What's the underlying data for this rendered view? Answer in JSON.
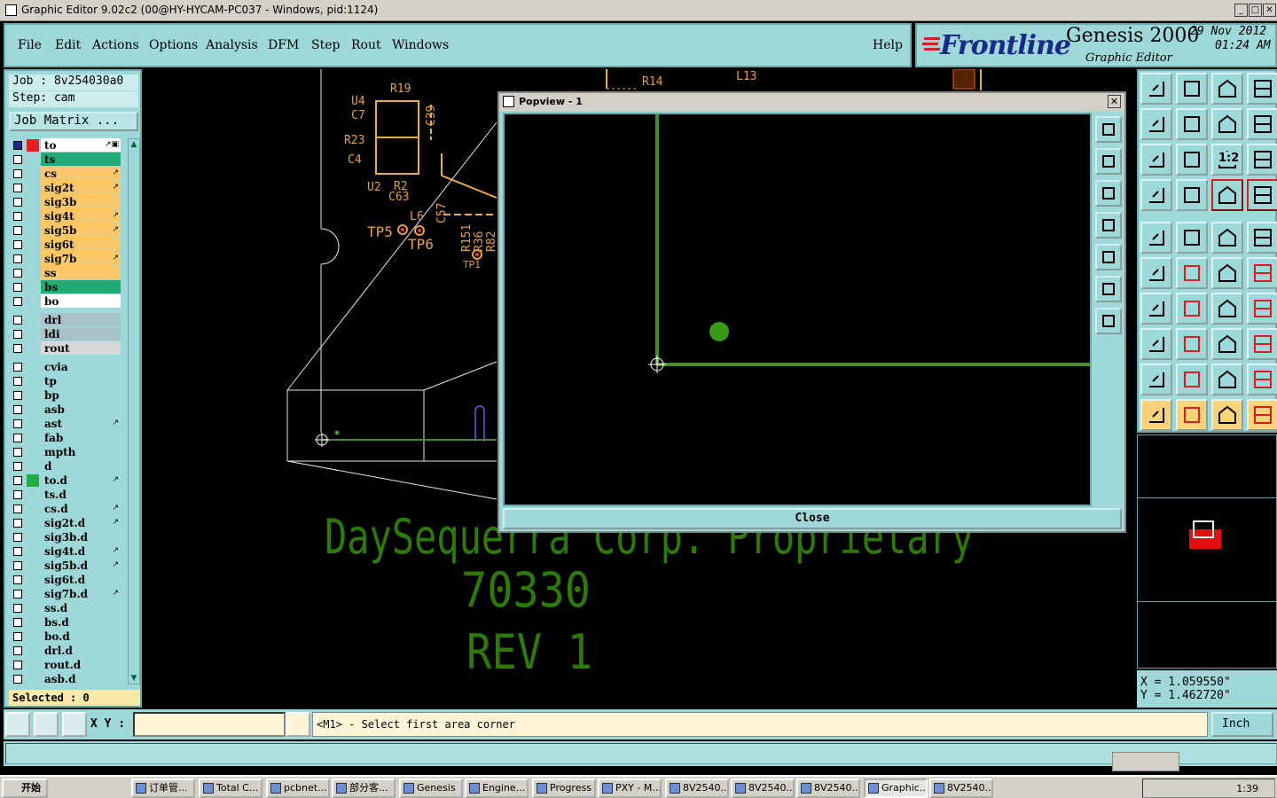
{
  "window": {
    "title": "Graphic Editor 9.02c2 (00@HY-HYCAM-PC037 - Windows, pid:1124)"
  },
  "menu": {
    "items": [
      "File",
      "Edit",
      "Actions",
      "Options",
      "Analysis",
      "DFM",
      "Step",
      "Rout",
      "Windows"
    ],
    "help": "Help"
  },
  "brand": {
    "logo": "Frontline",
    "product": "Genesis 2000",
    "subtitle": "Graphic Editor",
    "date": "29 Nov 2012",
    "time": "01:24 AM"
  },
  "job": {
    "job_line": "Job : 8v254030a0",
    "step_line": "Step: cam",
    "matrix_button": "Job Matrix ..."
  },
  "layers": [
    {
      "name": "to",
      "color": "#ffffff",
      "flag": "#e52020",
      "mark": "↗▣"
    },
    {
      "name": "ts",
      "color": "#22aa77",
      "flag": "",
      "mark": ""
    },
    {
      "name": "cs",
      "color": "#f9c86a",
      "flag": "",
      "mark": "↗"
    },
    {
      "name": "sig2t",
      "color": "#f9c86a",
      "flag": "",
      "mark": "↗"
    },
    {
      "name": "sig3b",
      "color": "#f9c86a",
      "flag": "",
      "mark": ""
    },
    {
      "name": "sig4t",
      "color": "#f9c86a",
      "flag": "",
      "mark": "↗"
    },
    {
      "name": "sig5b",
      "color": "#f9c86a",
      "flag": "",
      "mark": "↗"
    },
    {
      "name": "sig6t",
      "color": "#f9c86a",
      "flag": "",
      "mark": ""
    },
    {
      "name": "sig7b",
      "color": "#f9c86a",
      "flag": "",
      "mark": "↗"
    },
    {
      "name": "ss",
      "color": "#f9c86a",
      "flag": "",
      "mark": ""
    },
    {
      "name": "bs",
      "color": "#22aa77",
      "flag": "",
      "mark": ""
    },
    {
      "name": "bo",
      "color": "#ffffff",
      "flag": "",
      "mark": ""
    },
    {
      "name": "drl",
      "color": "#a8c4c8",
      "flag": "",
      "mark": ""
    },
    {
      "name": "ldi",
      "color": "#a8c4c8",
      "flag": "",
      "mark": ""
    },
    {
      "name": "rout",
      "color": "#d8d8d8",
      "flag": "",
      "mark": ""
    },
    {
      "name": "cvia",
      "color": "#9fd8d8",
      "flag": "",
      "mark": ""
    },
    {
      "name": "tp",
      "color": "#9fd8d8",
      "flag": "",
      "mark": ""
    },
    {
      "name": "bp",
      "color": "#9fd8d8",
      "flag": "",
      "mark": ""
    },
    {
      "name": "asb",
      "color": "#9fd8d8",
      "flag": "",
      "mark": ""
    },
    {
      "name": "ast",
      "color": "#9fd8d8",
      "flag": "",
      "mark": "↗"
    },
    {
      "name": "fab",
      "color": "#9fd8d8",
      "flag": "",
      "mark": ""
    },
    {
      "name": "mpth",
      "color": "#9fd8d8",
      "flag": "",
      "mark": ""
    },
    {
      "name": "d",
      "color": "#9fd8d8",
      "flag": "",
      "mark": ""
    },
    {
      "name": "to.d",
      "color": "#9fd8d8",
      "flag": "#22aa44",
      "mark": "↗"
    },
    {
      "name": "ts.d",
      "color": "#9fd8d8",
      "flag": "",
      "mark": ""
    },
    {
      "name": "cs.d",
      "color": "#9fd8d8",
      "flag": "",
      "mark": "↗"
    },
    {
      "name": "sig2t.d",
      "color": "#9fd8d8",
      "flag": "",
      "mark": "↗"
    },
    {
      "name": "sig3b.d",
      "color": "#9fd8d8",
      "flag": "",
      "mark": ""
    },
    {
      "name": "sig4t.d",
      "color": "#9fd8d8",
      "flag": "",
      "mark": "↗"
    },
    {
      "name": "sig5b.d",
      "color": "#9fd8d8",
      "flag": "",
      "mark": "↗"
    },
    {
      "name": "sig6t.d",
      "color": "#9fd8d8",
      "flag": "",
      "mark": ""
    },
    {
      "name": "sig7b.d",
      "color": "#9fd8d8",
      "flag": "",
      "mark": "↗"
    },
    {
      "name": "ss.d",
      "color": "#9fd8d8",
      "flag": "",
      "mark": ""
    },
    {
      "name": "bs.d",
      "color": "#9fd8d8",
      "flag": "",
      "mark": ""
    },
    {
      "name": "bo.d",
      "color": "#9fd8d8",
      "flag": "",
      "mark": ""
    },
    {
      "name": "drl.d",
      "color": "#9fd8d8",
      "flag": "",
      "mark": ""
    },
    {
      "name": "rout.d",
      "color": "#9fd8d8",
      "flag": "",
      "mark": ""
    },
    {
      "name": "asb.d",
      "color": "#9fd8d8",
      "flag": "",
      "mark": ""
    }
  ],
  "selected": "Selected : 0",
  "canvas": {
    "text_line1": "DaySequerra Corp. Proprietary",
    "text_line2": "70330",
    "text_line3": "REV 1",
    "labels": [
      "R19",
      "C39",
      "U4",
      "C7",
      "R23",
      "C4",
      "U2",
      "R2",
      "C63",
      "L6",
      "TP5",
      "TP6",
      "C57",
      "R151",
      "R36",
      "R82",
      "TP1",
      "R14",
      "L13"
    ]
  },
  "popview": {
    "title": "Popview - 1",
    "close_label": "Close"
  },
  "toolbox": {
    "icons": [
      "zoom-home-icon",
      "zoom-page-icon",
      "home-icon",
      "panel-icon",
      "pan-left-icon",
      "pan-right-icon",
      "undo-view-icon",
      "redraw-icon",
      "fit-icon",
      "zoom-fit-icon",
      "scale-icon",
      "help-icon",
      "settings-icon",
      "grid-icon",
      "layer-icon",
      "layer-compare-icon",
      "snap-icon",
      "draw-color-icon",
      "ruler-icon",
      "circle-icon",
      "connect-icon",
      "delete-icon",
      "link-icon",
      "link-red-icon",
      "line-icon",
      "line-red-icon",
      "arc-icon",
      "trace-icon",
      "pad-icon",
      "segment-icon",
      "measure-icon",
      "cluster-icon",
      "triangle-icon",
      "arrow-triangle-icon",
      "up-triangle-icon",
      "flat-triangle-icon",
      "select-icon",
      "select-box-icon",
      "select-clip-icon",
      "select-net-icon"
    ],
    "ratio_label": "1:2"
  },
  "coords": {
    "x": "X =  1.059550\"",
    "y": "Y =  1.462720\""
  },
  "cmd": {
    "xy_label": "X Y :",
    "xy_value": "",
    "prompt": "<M1> - Select first area corner",
    "units": "Inch"
  },
  "taskbar": {
    "start": "开始",
    "tasks": [
      "订单管...",
      "Total C...",
      "pcbnet...",
      "部分客...",
      "Genesis",
      "Engine...",
      "Progress",
      "PXY - M...",
      "8V2540...",
      "8V2540...",
      "8V2540...",
      "Graphic...",
      "8V2540..."
    ],
    "clock": "1:39"
  },
  "colors": {
    "panel": "#9fd8d8",
    "silk": "#2d7a0a",
    "popline": "#4a8a28",
    "ref": "#e8a040"
  }
}
